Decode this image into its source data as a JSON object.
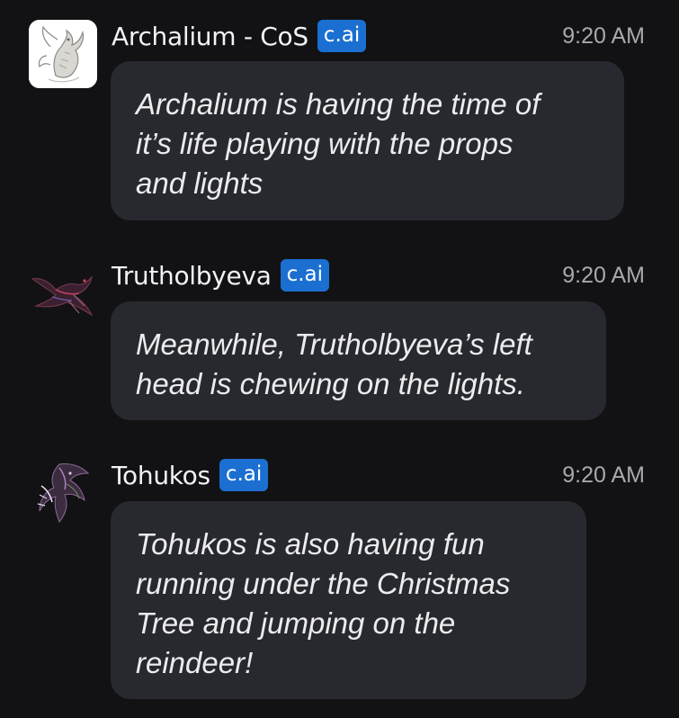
{
  "messages": [
    {
      "author": "Archalium - CoS",
      "badge": "c.ai",
      "time": "9:20 AM",
      "avatar_icon": "dragon-sketch-avatar",
      "text": "Archalium is having the time of\nit’s life playing with the props\nand lights"
    },
    {
      "author": "Trutholbyeva",
      "badge": "c.ai",
      "time": "9:20 AM",
      "avatar_icon": "dark-dragon-avatar",
      "text": "Meanwhile, Trutholbyeva’s left\nhead is chewing on the lights."
    },
    {
      "author": "Tohukos",
      "badge": "c.ai",
      "time": "9:20 AM",
      "avatar_icon": "winged-dragon-avatar",
      "text": "Tohukos is also having fun\nrunning under the Christmas\nTree and jumping on the\nreindeer!"
    }
  ],
  "colors": {
    "background": "#121214",
    "bubble": "#27292e",
    "badge": "#1b6fd1",
    "timestamp": "#a7a9ae"
  }
}
